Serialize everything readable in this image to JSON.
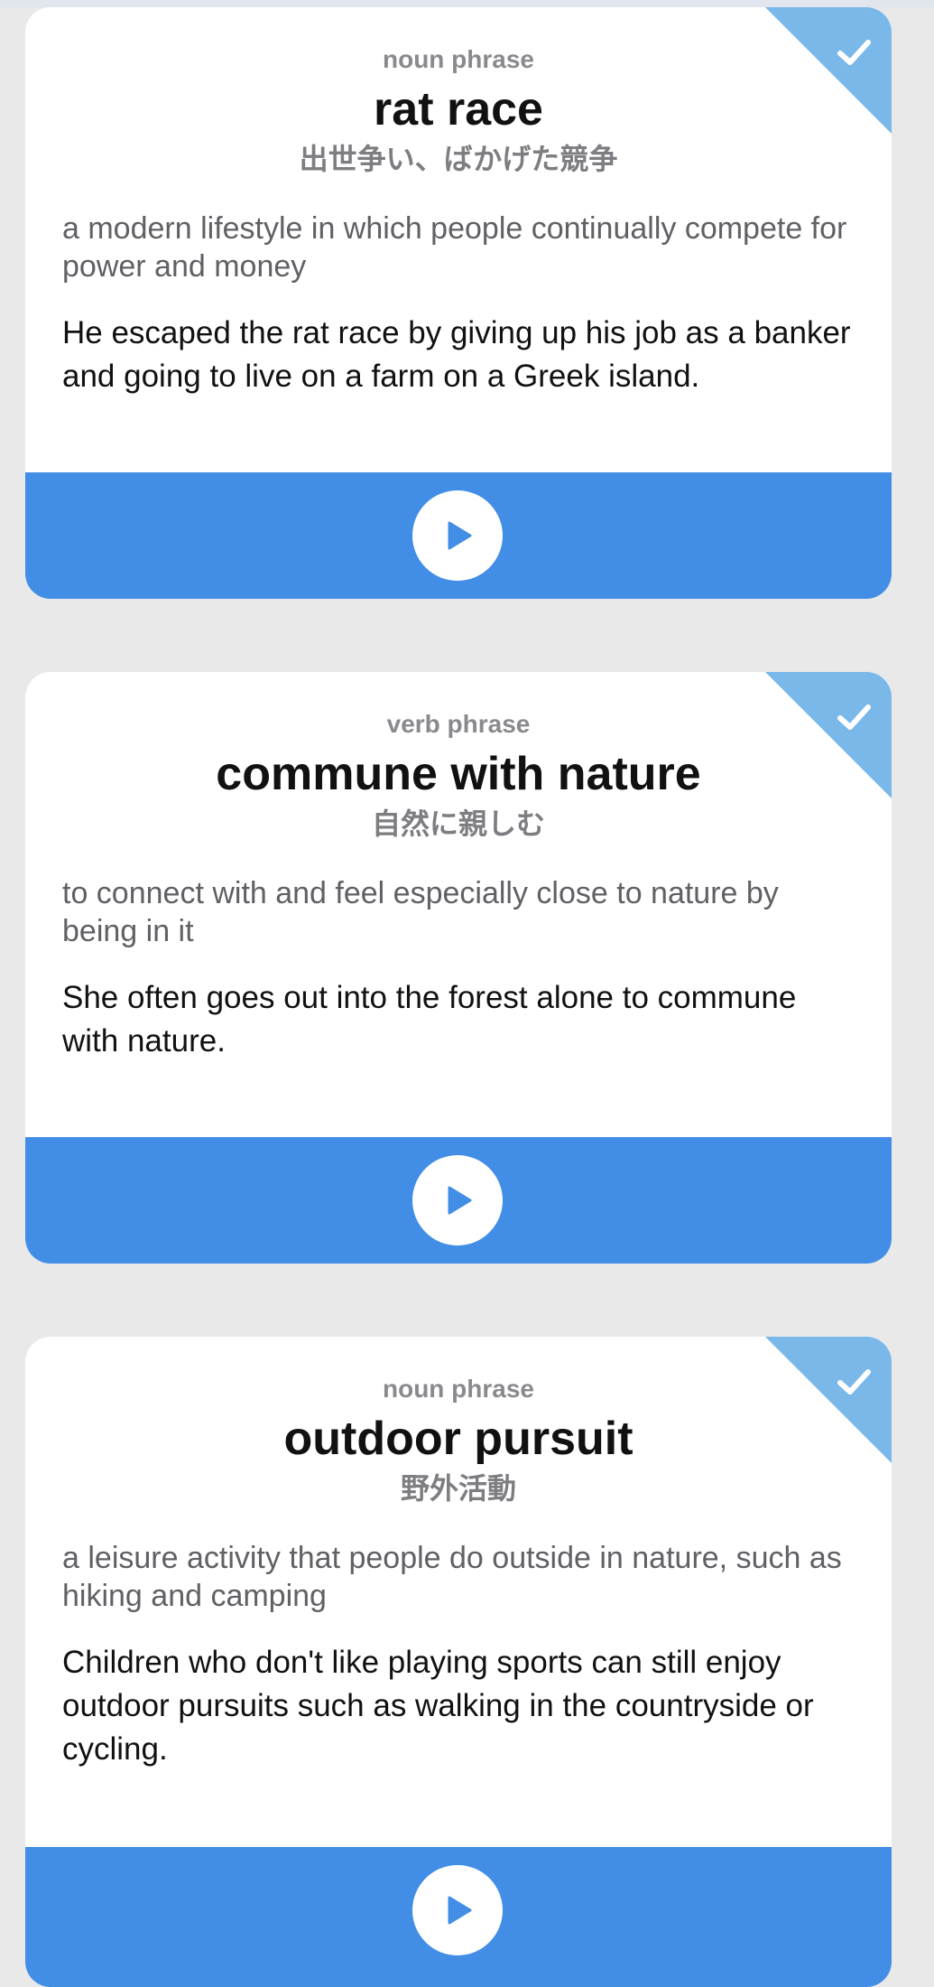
{
  "colors": {
    "background": "#e9e9ea",
    "card": "#ffffff",
    "accent_blue": "#428ee6",
    "corner_blue": "#7ab8ea",
    "muted_text": "#8a8a8e",
    "definition_text": "#606065",
    "primary_text": "#111111"
  },
  "cards": [
    {
      "part_of_speech": "noun phrase",
      "term": "rat race",
      "translation": "出世争い、ばかげた競争",
      "definition": "a modern lifestyle in which people continually compete for power and money",
      "example": "He escaped the rat race by giving up his job as a banker and going to live on a farm on a Greek island.",
      "learned": true,
      "icons": {
        "status": "checkmark-icon",
        "audio": "play-icon"
      }
    },
    {
      "part_of_speech": "verb phrase",
      "term": "commune with nature",
      "translation": "自然に親しむ",
      "definition": "to connect with and feel especially close to nature by being in it",
      "example": "She often goes out into the forest alone to commune with nature.",
      "learned": true,
      "icons": {
        "status": "checkmark-icon",
        "audio": "play-icon"
      }
    },
    {
      "part_of_speech": "noun phrase",
      "term": "outdoor pursuit",
      "translation": "野外活動",
      "definition": "a leisure activity that people do outside in nature, such as hiking and camping",
      "example": "Children who don't like playing sports can still enjoy outdoor pursuits such as walking in the countryside or cycling.",
      "learned": true,
      "icons": {
        "status": "checkmark-icon",
        "audio": "play-icon"
      }
    }
  ]
}
